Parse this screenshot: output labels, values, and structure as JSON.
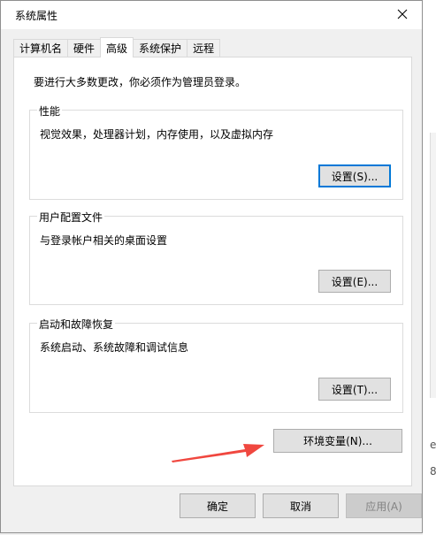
{
  "window": {
    "title": "系统属性"
  },
  "tabs": [
    {
      "label": "计算机名",
      "active": false
    },
    {
      "label": "硬件",
      "active": false
    },
    {
      "label": "高级",
      "active": true
    },
    {
      "label": "系统保护",
      "active": false
    },
    {
      "label": "远程",
      "active": false
    }
  ],
  "advanced": {
    "admin_note": "要进行大多数更改，你必须作为管理员登录。",
    "performance": {
      "title": "性能",
      "description": "视觉效果，处理器计划，内存使用，以及虚拟内存",
      "button": "设置(S)..."
    },
    "user_profiles": {
      "title": "用户配置文件",
      "description": "与登录帐户相关的桌面设置",
      "button": "设置(E)..."
    },
    "startup_recovery": {
      "title": "启动和故障恢复",
      "description": "系统启动、系统故障和调试信息",
      "button": "设置(T)..."
    },
    "env_button": "环境变量(N)..."
  },
  "footer": {
    "ok": "确定",
    "cancel": "取消",
    "apply": "应用(A)"
  },
  "annotation": {
    "arrow_color": "#f0473f"
  },
  "background_window": {
    "fragments": [
      "e",
      "8"
    ]
  },
  "colors": {
    "focus_border": "#0078d7",
    "button_face": "#e1e1e1",
    "dialog_bg": "#f0f0f0"
  }
}
